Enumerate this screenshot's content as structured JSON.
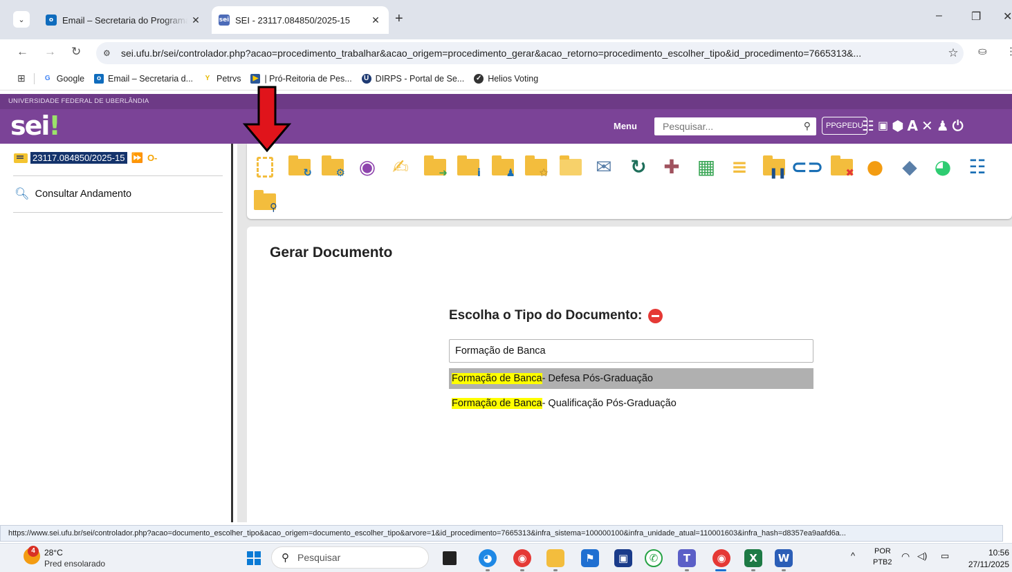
{
  "browser": {
    "tabs": [
      {
        "title": "Email – Secretaria do Programa",
        "active": false
      },
      {
        "title": "SEI - 23117.084850/2025-15",
        "active": true
      }
    ],
    "fav_sei": "sei",
    "new_tab": "+",
    "window_controls": {
      "minimize": "–",
      "restore": "❐",
      "close": "✕"
    },
    "url": "sei.ufu.br/sei/controlador.php?acao=procedimento_trabalhar&acao_origem=procedimento_gerar&acao_retorno=procedimento_escolher_tipo&id_procedimento=7665313&...",
    "bookmarks": [
      {
        "label": "Google",
        "icon": "google-icon",
        "color": "#4285f4"
      },
      {
        "label": "Email – Secretaria d...",
        "icon": "outlook-icon",
        "color": "#0f6cbd"
      },
      {
        "label": "Petrvs",
        "icon": "petrvs-icon",
        "color": "#f0c000"
      },
      {
        "label": "| Pró-Reitoria de Pes...",
        "icon": "progep-icon",
        "color": "#2b5797"
      },
      {
        "label": "DIRPS - Portal de Se...",
        "icon": "dirps-icon",
        "color": "#1f3b73"
      },
      {
        "label": "Helios Voting",
        "icon": "helios-icon",
        "color": "#333333"
      }
    ]
  },
  "sei": {
    "university": "UNIVERSIDADE FEDERAL DE UBERLÂNDIA",
    "logo_main": "sei",
    "logo_accent": "!",
    "menu_label": "Menu",
    "search_placeholder": "Pesquisar...",
    "unit": "PPGPEDU",
    "colors": {
      "header_top": "#6d3a86",
      "header": "#7b4397",
      "folder": "#f3bd3d",
      "highlight": "#ffff00"
    }
  },
  "left_panel": {
    "process_number": "23117.084850/2025-15",
    "consultar": "Consultar Andamento"
  },
  "toolbar": {
    "icons": [
      "incluir-documento-icon",
      "atualizar-andamento-icon",
      "gerenciar-acesso-icon",
      "acompanhamento-icon",
      "assinar-icon",
      "enviar-processo-icon",
      "informacoes-icon",
      "atribuir-icon",
      "favorito-icon",
      "sobrestar-icon",
      "enviar-email-icon",
      "relacionar-icon",
      "anexar-icon",
      "unidades-icon",
      "anotacoes-icon",
      "pausar-icon",
      "link-icon",
      "excluir-icon",
      "comentario-icon",
      "marcador-icon",
      "prazo-icon",
      "lista-icon",
      "pesquisar-processo-icon"
    ]
  },
  "main": {
    "title": "Gerar Documento",
    "choose_label": "Escolha o Tipo do Documento:",
    "input_value": "Formação de Banca",
    "suggestions": [
      {
        "match": "Formação de Banca",
        "rest": " - Defesa Pós-Graduação",
        "highlighted": true
      },
      {
        "match": "Formação de Banca",
        "rest": " - Qualificação Pós-Graduação",
        "highlighted": false
      }
    ]
  },
  "status_url": "https://www.sei.ufu.br/sei/controlador.php?acao=documento_escolher_tipo&acao_origem=documento_escolher_tipo&arvore=1&id_procedimento=7665313&infra_sistema=100000100&infra_unidade_atual=110001603&infra_hash=d8357ea9aafd6a...",
  "taskbar": {
    "weather_badge": "4",
    "temperature": "28°C",
    "condition": "Pred ensolarado",
    "search_placeholder": "Pesquisar",
    "language": "POR",
    "layout": "PTB2",
    "time": "10:56",
    "date": "27/11/2025"
  }
}
